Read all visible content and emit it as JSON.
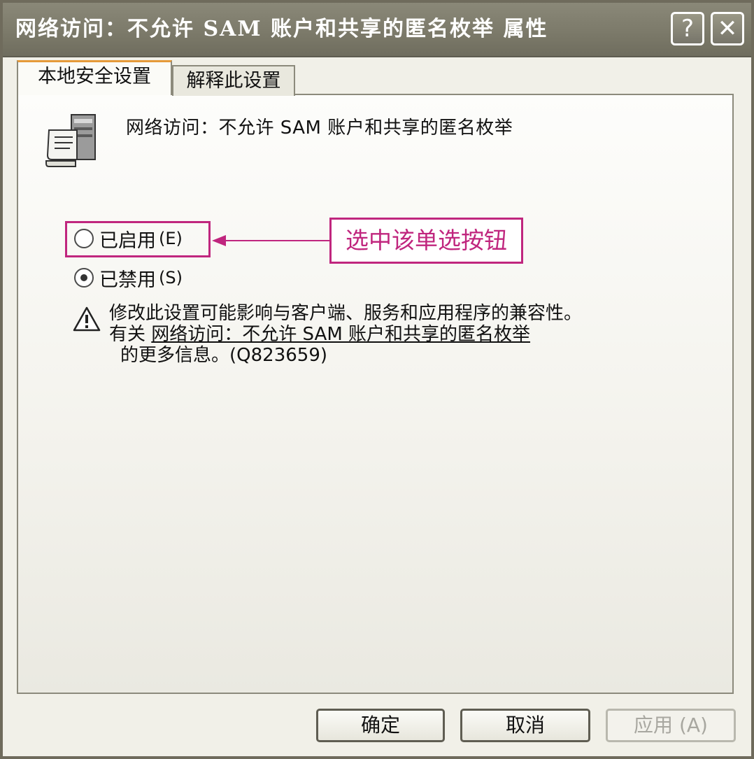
{
  "window": {
    "title": "网络访问：不允许 SAM 账户和共享的匿名枚举 属性"
  },
  "titlebar": {
    "help_label": "?",
    "close_label": "✕"
  },
  "tabs": [
    {
      "label": "本地安全设置",
      "active": true
    },
    {
      "label": "解释此设置",
      "active": false
    }
  ],
  "policy": {
    "name": "网络访问：不允许 SAM 账户和共享的匿名枚举"
  },
  "options": {
    "enabled": {
      "label": "已启用",
      "accel": "(E)",
      "checked": false
    },
    "disabled": {
      "label": "已禁用",
      "accel": "(S)",
      "checked": true
    }
  },
  "annotation": {
    "text": "选中该单选按钮"
  },
  "warning": {
    "line1": "修改此设置可能影响与客户端、服务和应用程序的兼容性。",
    "prefix": "有关",
    "link": "网络访问：不允许 SAM 账户和共享的匿名枚举",
    "line3": "的更多信息。(Q823659)"
  },
  "buttons": {
    "ok": "确定",
    "cancel": "取消",
    "apply": "应用 (A)"
  }
}
